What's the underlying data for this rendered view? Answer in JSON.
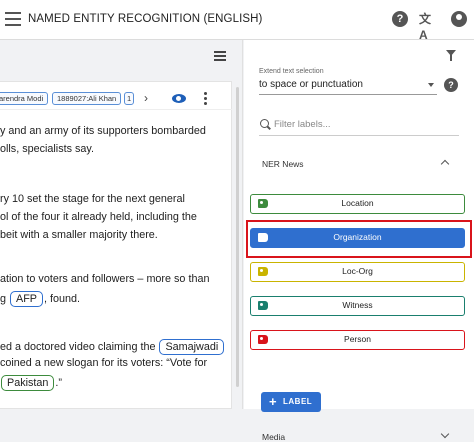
{
  "header": {
    "title": "NAMED ENTITY RECOGNITION (ENGLISH)",
    "help_glyph": "?",
    "translate_glyph": "文A"
  },
  "annotation_panel": {
    "tags": [
      "arendra Modi",
      "1889027:Ali Khan",
      "1"
    ],
    "next_glyph": "›"
  },
  "text_lines": [
    {
      "pre": "y and an army of its supporters bombarded",
      "ent": null
    },
    {
      "pre": "olls, specialists say.",
      "ent": null
    },
    {
      "pre": "ry 10 set the stage for the next general",
      "ent": null
    },
    {
      "pre": "ol of the four it already held, including the",
      "ent": null
    },
    {
      "pre": "beit with a smaller majority there.",
      "ent": null
    },
    {
      "pre": "ation to voters and followers – more so than",
      "ent": null
    },
    {
      "pre": "g ",
      "ent": "AFP",
      "ent_type": "org",
      "post": ", found."
    },
    {
      "pre": "ed a doctored video claiming the ",
      "ent": "Samajwadi",
      "ent_type": "org",
      "post": ""
    },
    {
      "pre": "coined a new slogan for its voters: “Vote for",
      "ent": null
    },
    {
      "pre": "",
      "ent": "Pakistan",
      "ent_type": "loc",
      "post": ".”"
    }
  ],
  "sidebar": {
    "extend_label": "Extend text selection",
    "extend_value": "to space or punctuation",
    "help_glyph": "?",
    "search_placeholder": "Filter labels...",
    "group_title": "NER News",
    "labels": [
      {
        "name": "Location",
        "color": "#3d8b3d",
        "selected": false
      },
      {
        "name": "Organization",
        "color": "#2f6fcf",
        "selected": true
      },
      {
        "name": "Loc-Org",
        "color": "#c9b400",
        "selected": false
      },
      {
        "name": "Witness",
        "color": "#1a7f6e",
        "selected": false
      },
      {
        "name": "Person",
        "color": "#d9141b",
        "selected": false
      }
    ],
    "add_label_button": "LABEL",
    "add_glyph": "+",
    "second_group_title": "Media"
  }
}
